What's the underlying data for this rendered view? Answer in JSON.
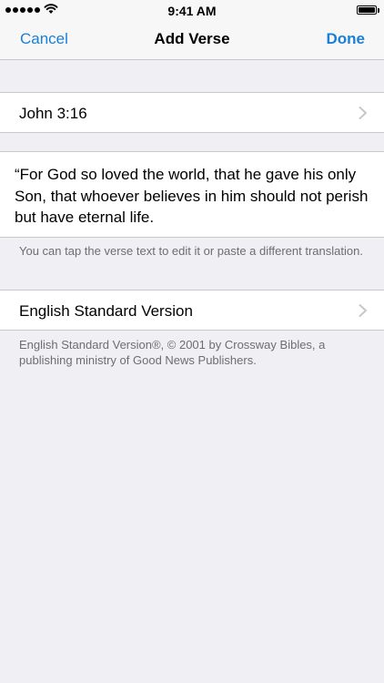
{
  "status_bar": {
    "time": "9:41 AM",
    "signal_icon": "signal-dots-icon",
    "wifi_icon": "wifi-icon",
    "battery_icon": "battery-icon",
    "battery_level": 1.0
  },
  "nav": {
    "cancel_label": "Cancel",
    "title": "Add Verse",
    "done_label": "Done",
    "accent_color": "#1a7fd5"
  },
  "reference": {
    "label": "John 3:16",
    "chevron_icon": "chevron-right-icon"
  },
  "verse": {
    "text": "“For God so loved the world, that he gave his only Son, that whoever believes in him should not perish but have eternal life."
  },
  "hint": {
    "text": "You can tap the verse text to edit it or paste a different translation."
  },
  "translation": {
    "label": "English Standard Version",
    "chevron_icon": "chevron-right-icon"
  },
  "copyright": {
    "text": "English Standard Version®, © 2001 by Crossway Bibles, a publishing ministry of Good News Publishers."
  }
}
